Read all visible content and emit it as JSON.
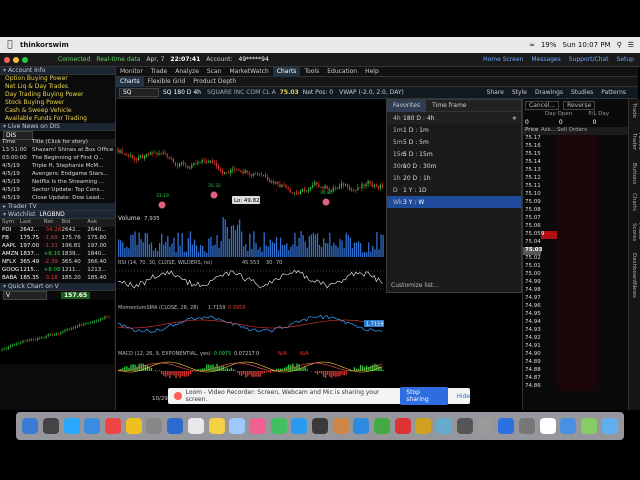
{
  "menubar": {
    "app": "thinkorswim",
    "items": [
      "Connected",
      "Real-time data",
      "Apr, 7",
      "22:07:41",
      "Account:",
      "49*****94"
    ],
    "right": [
      "19%",
      "Sun 10:07 PM"
    ]
  },
  "toolbar": {
    "status_connected": "Connected",
    "status_data": "Real-time data",
    "date": "Apr, 7",
    "time": "22:07:41",
    "account_label": "Account:",
    "account_num": "49*****94",
    "buttons": [
      "Home Screen",
      "Messages",
      "Support/Chat",
      "Setup"
    ],
    "ondemand": "OnDemand"
  },
  "tabs": [
    "Monitor",
    "Trade",
    "Analyze",
    "Scan",
    "MarketWatch",
    "Charts",
    "Tools",
    "Education",
    "Help"
  ],
  "subtabs": [
    "Charts",
    "Flexible Grid",
    "Product Depth"
  ],
  "symbar": {
    "symbol": "SQ",
    "period": "SQ 180 D 4h",
    "company": "SQUARE INC COM CL A",
    "price": "75.03",
    "netpos": "Net Pos: 0",
    "vwap": "VWAP (-2.0, 2.0, DAY)",
    "links": [
      "Share",
      "Style",
      "Drawings",
      "Studies",
      "Patterns"
    ]
  },
  "left": {
    "account_head": "Account Info",
    "account_rows": [
      "Option Buying Power",
      "Net Liq & Day Trades",
      "Day Trading Buying Power",
      "Stock Buying Power",
      "Cash & Sweep Vehicle",
      "Available Funds For Trading"
    ],
    "news_head": "Live News on DIS",
    "news_symbol": "DIS",
    "news_cols": [
      "Time",
      "Title (Click for story)"
    ],
    "news": [
      {
        "t": "13:51:00",
        "s": "Shazam! Shines at Box Office"
      },
      {
        "t": "03:00:00",
        "s": "The Beginning of First Q..."
      },
      {
        "t": "4/5/19",
        "s": "Triple H, Stephanie McM..."
      },
      {
        "t": "4/5/19",
        "s": "Avengers: Endgame Stars..."
      },
      {
        "t": "4/5/19",
        "s": "Netflix Is the Streaming ..."
      },
      {
        "t": "4/5/19",
        "s": "Sector Update: Top Cons..."
      },
      {
        "t": "4/5/19",
        "s": "Close Update: Dow Lead..."
      }
    ],
    "tv_head": "Trader TV",
    "wl_head": "Watchlist",
    "wl_name": "LRGBND",
    "wl_cols": [
      "Sym",
      "Last",
      "Net",
      "Bid",
      "Ask"
    ],
    "watchlist": [
      {
        "sym": "PDI",
        "last": "2642...",
        "net": "-34.26",
        "bid": "2642...",
        "ask": "2640..."
      },
      {
        "sym": "FB",
        "last": "175.75",
        "net": "-1.69",
        "bid": "175.76",
        "ask": "175.80"
      },
      {
        "sym": "AAPL",
        "last": "197.00",
        "net": "-1.31",
        "bid": "196.81",
        "ask": "197.00"
      },
      {
        "sym": "AMZN",
        "last": "1837...",
        "net": "+8.16",
        "bid": "1839...",
        "ask": "1840..."
      },
      {
        "sym": "NFLX",
        "last": "365.49",
        "net": "-2.39",
        "bid": "365.40",
        "ask": "366.40"
      },
      {
        "sym": "GOOG",
        "last": "1215...",
        "net": "+8.08",
        "bid": "1211...",
        "ask": "1213..."
      },
      {
        "sym": "BABA",
        "last": "185.35",
        "net": "-3.18",
        "bid": "185.20",
        "ask": "185.40"
      }
    ],
    "qc_head": "Quick Chart on V",
    "qc_symbol": "V",
    "qc_price": "157.65"
  },
  "chart": {
    "volume_label": "Volume",
    "volume_val": "7,935",
    "rsi_label": "RSI (14, 70, 30, CLOSE, WILDERS, no)",
    "rsi_val": "45.553",
    "rsi_vals": [
      "30",
      "70"
    ],
    "mom_label": "MomentumSMA (CLOSE, 28, 28)",
    "mom_val": "1.7159",
    "mom_val2": "0.3959",
    "mom_badge": "1.7159",
    "mom_axis": [
      "-20",
      "-2.5",
      "-5"
    ],
    "macd_label": "MACD (12, 26, 9, EXPONENTIAL, yes)",
    "macd_vals": [
      "-0.0975",
      "0.07217",
      "0",
      "N/A",
      "N/A"
    ],
    "low_badge": "Lo: 49.82",
    "date_label": "10/29",
    "marker_labels": [
      "33.19",
      "34.80",
      "35.32"
    ]
  },
  "dropdown": {
    "tab_fav": "Favorites",
    "tab_tf": "Time frame",
    "title": "180 D : 4h",
    "title_key": "4h",
    "options": [
      {
        "k": "1m",
        "v": "1 D : 1m"
      },
      {
        "k": "5m",
        "v": "5 D : 5m"
      },
      {
        "k": "15m",
        "v": "5 D : 15m"
      },
      {
        "k": "30m",
        "v": "10 D : 30m"
      },
      {
        "k": "1h",
        "v": "20 D : 1h"
      },
      {
        "k": "D",
        "v": "1 Y : 1D"
      },
      {
        "k": "Wk",
        "v": "3 Y : W"
      }
    ],
    "selected_index": 6,
    "customize": "Customize list..."
  },
  "rightpanel": {
    "top_btns": [
      "Cancel...",
      "Reverse"
    ],
    "labels": [
      "Day Open",
      "P/L Day"
    ],
    "top_vals": [
      "0",
      "0",
      "0"
    ],
    "cols": [
      "Price",
      "Ask...",
      "Sell Orders"
    ],
    "prices": [
      "75.17",
      "75.16",
      "75.15",
      "75.14",
      "75.13",
      "75.12",
      "75.11",
      "75.10",
      "75.09",
      "75.08",
      "75.07",
      "75.06",
      "75.05",
      "75.04",
      "75.03",
      "75.02",
      "75.01",
      "75.00",
      "74.99",
      "74.98",
      "74.97",
      "74.96",
      "74.95",
      "74.94",
      "74.93",
      "74.92",
      "74.91",
      "74.90",
      "74.89",
      "74.88",
      "74.87",
      "74.86"
    ],
    "ask_size": "9",
    "vtabs": [
      "Trade",
      "Active Trader",
      "Buttons",
      "Charts",
      "Phase Scores",
      "Dashboard",
      "News"
    ]
  },
  "sharebar": {
    "text": "Loom - Video Recorder: Screen, Webcam and Mic is sharing your screen.",
    "stop": "Stop sharing",
    "hide": "Hide"
  },
  "colors": {
    "up": "#2ecc40",
    "down": "#e53935",
    "accent": "#e8d44d",
    "select": "#1f4b9a"
  }
}
